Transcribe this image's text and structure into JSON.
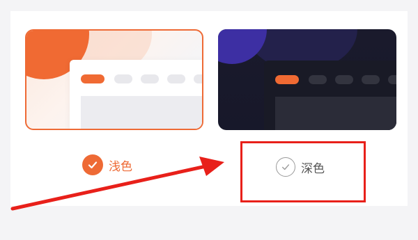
{
  "theme_selector": {
    "options": [
      {
        "label": "浅色",
        "selected": true
      },
      {
        "label": "深色",
        "selected": false
      }
    ]
  },
  "colors": {
    "accent": "#ee6a35",
    "annotation": "#e8201a",
    "dark_card_bg": "#1a1a2c",
    "page_bg": "#f4f4f6"
  },
  "icons": {
    "selected": "check-circle-filled-icon",
    "unselected": "check-circle-outline-icon"
  },
  "annotation": {
    "type": "red-arrow-and-highlight-box",
    "target": "深色"
  }
}
